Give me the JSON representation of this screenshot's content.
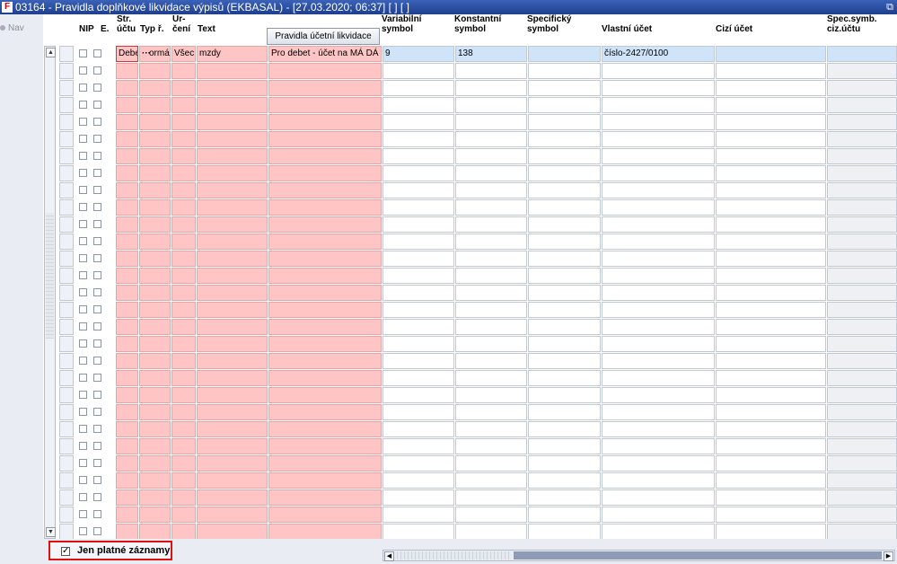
{
  "window": {
    "title": "03164 - Pravidla doplňkové likvidace výpisů (EKBASAL) - [27.03.2020; 06:37]  [ ]  [ ]",
    "app_icon": "F",
    "restore_glyph": "⧉"
  },
  "left_panel": {
    "nav_label": "Nav"
  },
  "columns": [
    {
      "key": "nip",
      "line1": "",
      "line2": "NIP"
    },
    {
      "key": "e",
      "line1": "",
      "line2": "E."
    },
    {
      "key": "str_uctu",
      "line1": "Str.",
      "line2": "účtu"
    },
    {
      "key": "typ_r",
      "line1": "",
      "line2": "Typ ř."
    },
    {
      "key": "urceni",
      "line1": "Ur-",
      "line2": "čení"
    },
    {
      "key": "text",
      "line1": "",
      "line2": "Text"
    },
    {
      "key": "pravidla",
      "button": "Pravidla účetní likvidace"
    },
    {
      "key": "variabilni",
      "line1": "Variabilní",
      "line2": "symbol"
    },
    {
      "key": "konstantni",
      "line1": "Konstantní",
      "line2": "symbol"
    },
    {
      "key": "specificky",
      "line1": "Specifický",
      "line2": "symbol"
    },
    {
      "key": "vlastni",
      "line1": "",
      "line2": "Vlastní účet"
    },
    {
      "key": "cizi",
      "line1": "",
      "line2": "Cizí účet"
    },
    {
      "key": "spec_symb",
      "line1": "Spec.symb.",
      "line2": "ciz.účtu"
    }
  ],
  "first_row": {
    "str_uctu": "Debe",
    "typ_r_button": "···",
    "typ_r": "ormá",
    "urceni": "Všec",
    "text": "mzdy",
    "pravidla": "Pro debet - účet na MÁ DÁ",
    "variabilni": "9",
    "konstantni": "138",
    "specificky": "",
    "vlastni": "číslo-2427/0100",
    "cizi": "",
    "spec_symb": ""
  },
  "empty_row_count": 28,
  "filter": {
    "label": "Jen platné záznamy",
    "checked_glyph": "✓",
    "checked": true
  },
  "scroll": {
    "up_glyph": "▲",
    "down_glyph": "▼",
    "left_glyph": "◀",
    "right_glyph": "▶"
  },
  "colors": {
    "titlebar": "#1f3f8e",
    "pink": "#ffc4c4",
    "selected_row": "#cfe4f9",
    "highlight_border": "#e01010"
  }
}
